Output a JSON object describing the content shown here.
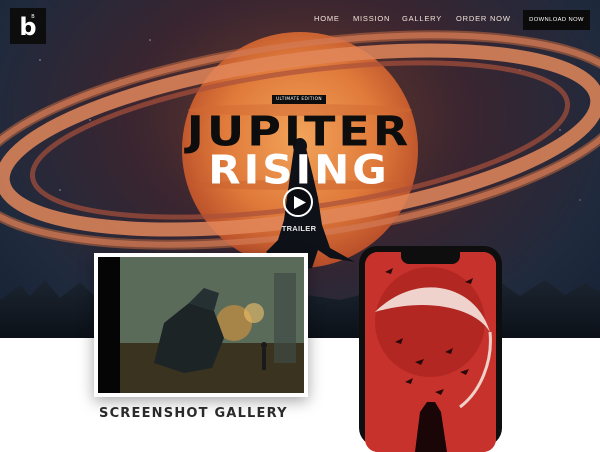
{
  "brand": {
    "logo_letter": "b",
    "logo_badge": "B"
  },
  "nav": {
    "items": [
      {
        "label": "HOME"
      },
      {
        "label": "MISSION"
      },
      {
        "label": "GALLERY"
      },
      {
        "label": "ORDER NOW"
      }
    ],
    "download_label": "DOWNLOAD NOW"
  },
  "hero": {
    "edition_badge": "ULTIMATE EDITION",
    "title_line1": "JUPITER",
    "title_line2": "RISING",
    "trailer_label": "TRAILER",
    "play_icon": "play-icon"
  },
  "gallery": {
    "heading": "SCREENSHOT GALLERY"
  },
  "colors": {
    "planet": "#e07a3a",
    "sky": "#1f2a3d",
    "title_dark": "#0d0d0d",
    "phone_screen": "#c7332c"
  }
}
